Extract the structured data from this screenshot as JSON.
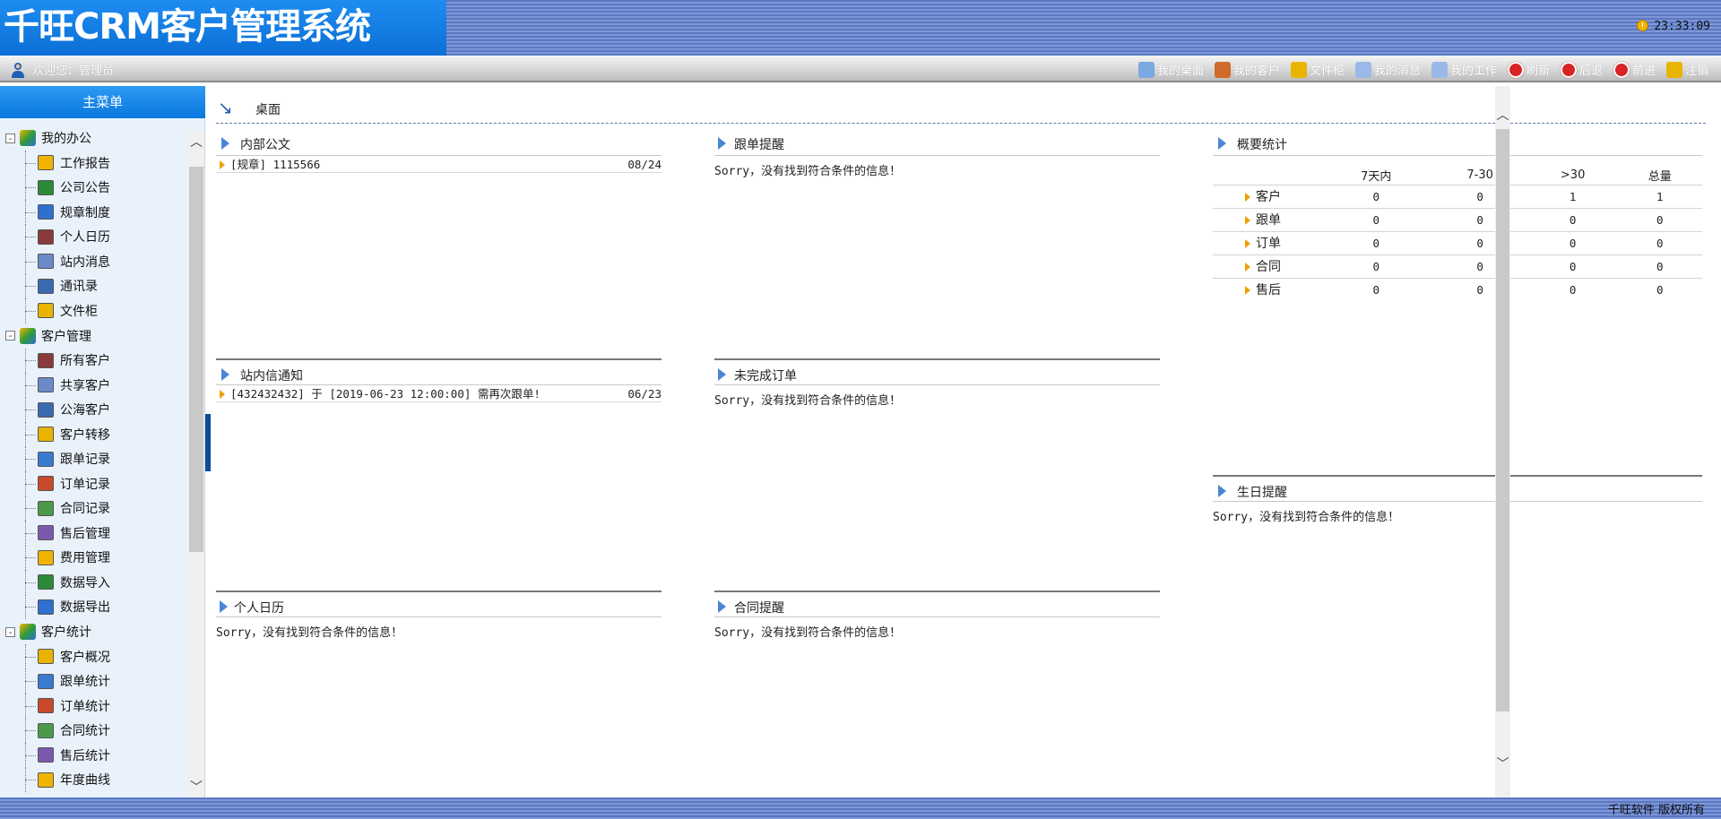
{
  "header": {
    "logo": "千旺CRM客户管理系统",
    "clock": "23:33:09"
  },
  "toolbar": {
    "welcome": "欢迎您：管理员",
    "links": [
      {
        "label": "我的桌面",
        "icon": "desktop-icon",
        "color": "#7aa8e0"
      },
      {
        "label": "我的客户",
        "icon": "gift-icon",
        "color": "#d06a2a"
      },
      {
        "label": "文件柜",
        "icon": "folder-icon",
        "color": "#e8b400"
      },
      {
        "label": "我的消息",
        "icon": "mail-icon",
        "color": "#9ab8e8"
      },
      {
        "label": "我的工作",
        "icon": "edit-icon",
        "color": "#9ab8e8"
      },
      {
        "label": "刷新",
        "icon": "refresh-icon",
        "color": "#d82424"
      },
      {
        "label": "后退",
        "icon": "back-icon",
        "color": "#d82424"
      },
      {
        "label": "前进",
        "icon": "forward-icon",
        "color": "#d82424"
      },
      {
        "label": "注销",
        "icon": "key-icon",
        "color": "#e8b400"
      }
    ]
  },
  "sidebar": {
    "title": "主菜单",
    "groups": [
      {
        "label": "我的办公",
        "toggle": "-",
        "items": [
          "工作报告",
          "公司公告",
          "规章制度",
          "个人日历",
          "站内消息",
          "通讯录",
          "文件柜"
        ]
      },
      {
        "label": "客户管理",
        "toggle": "-",
        "items": [
          "所有客户",
          "共享客户",
          "公海客户",
          "客户转移",
          "跟单记录",
          "订单记录",
          "合同记录",
          "售后管理",
          "费用管理",
          "数据导入",
          "数据导出"
        ]
      },
      {
        "label": "客户统计",
        "toggle": "-",
        "items": [
          "客户概况",
          "跟单统计",
          "订单统计",
          "合同统计",
          "售后统计",
          "年度曲线"
        ]
      }
    ]
  },
  "main": {
    "crumb": "桌面",
    "panels": {
      "announcements": {
        "title": "内部公文",
        "entries": [
          {
            "text": "[规章] 1115566",
            "date": "08/24"
          }
        ]
      },
      "followup": {
        "title": "跟单提醒",
        "message": "Sorry，没有找到符合条件的信息！"
      },
      "summary": {
        "title": "概要统计",
        "columns": [
          "7天内",
          "7-30",
          ">30",
          "总量"
        ],
        "rows": [
          {
            "label": "客户",
            "values": [
              "0",
              "0",
              "1",
              "1"
            ]
          },
          {
            "label": "跟单",
            "values": [
              "0",
              "0",
              "0",
              "0"
            ]
          },
          {
            "label": "订单",
            "values": [
              "0",
              "0",
              "0",
              "0"
            ]
          },
          {
            "label": "合同",
            "values": [
              "0",
              "0",
              "0",
              "0"
            ]
          },
          {
            "label": "售后",
            "values": [
              "0",
              "0",
              "0",
              "0"
            ]
          }
        ]
      },
      "notices": {
        "title": "站内信通知",
        "entries": [
          {
            "text": "[432432432] 于 [2019-06-23 12:00:00] 需再次跟单!",
            "date": "06/23"
          }
        ]
      },
      "orders": {
        "title": "未完成订单",
        "message": "Sorry，没有找到符合条件的信息！"
      },
      "birthday": {
        "title": "生日提醒",
        "message": "Sorry，没有找到符合条件的信息！"
      },
      "calendar": {
        "title": "个人日历",
        "message": "Sorry，没有找到符合条件的信息！"
      },
      "contracts": {
        "title": "合同提醒",
        "message": "Sorry，没有找到符合条件的信息！"
      }
    }
  },
  "footer": {
    "text": "千旺软件 版权所有"
  }
}
